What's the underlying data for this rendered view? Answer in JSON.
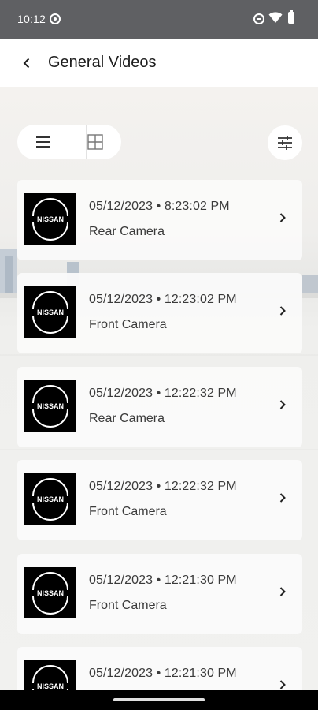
{
  "status_bar": {
    "time": "10:12"
  },
  "header": {
    "title": "General Videos"
  },
  "toolbar": {
    "list_view_icon": "list-icon",
    "grid_view_icon": "grid-icon",
    "filter_icon": "filter-sliders-icon"
  },
  "brand": {
    "logo_text": "NISSAN"
  },
  "videos": [
    {
      "date": "05/12/2023 • 8:23:02 PM",
      "camera": "Rear Camera"
    },
    {
      "date": "05/12/2023 • 12:23:02 PM",
      "camera": "Front Camera"
    },
    {
      "date": "05/12/2023 • 12:22:32 PM",
      "camera": "Rear Camera"
    },
    {
      "date": "05/12/2023 • 12:22:32 PM",
      "camera": "Front Camera"
    },
    {
      "date": "05/12/2023 • 12:21:30 PM",
      "camera": "Front Camera"
    },
    {
      "date": "05/12/2023 • 12:21:30 PM",
      "camera": ""
    }
  ]
}
